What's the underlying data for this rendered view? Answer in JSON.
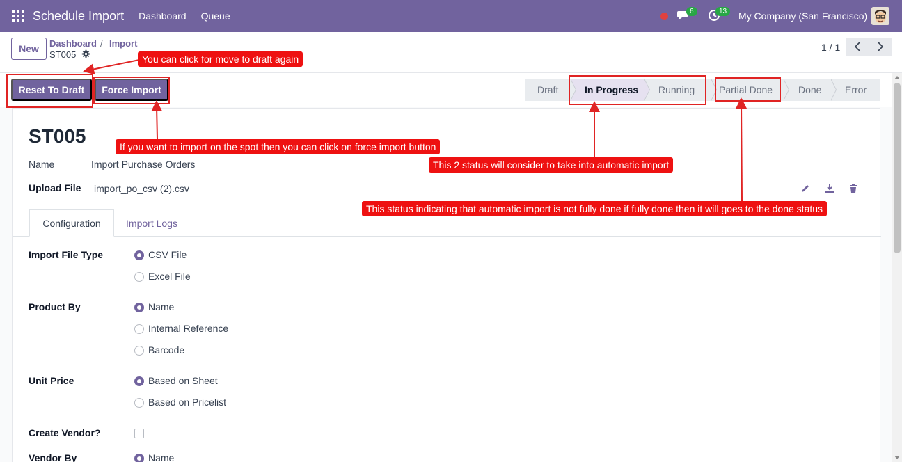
{
  "navbar": {
    "app_title": "Schedule Import",
    "links": [
      "Dashboard",
      "Queue"
    ],
    "messages_badge": "6",
    "activities_badge": "13",
    "company": "My Company (San Francisco)",
    "colors": {
      "brand": "#71639e",
      "badge": "#28a745",
      "recording": "#e0413f"
    }
  },
  "control_panel": {
    "new_label": "New",
    "breadcrumb": {
      "parent": "Dashboard",
      "separator": "/",
      "current": "Import"
    },
    "record_name": "ST005",
    "pager": "1 / 1"
  },
  "statusbar": {
    "buttons": {
      "reset_to_draft": "Reset To Draft",
      "force_import": "Force Import"
    },
    "stages": [
      {
        "label": "Draft",
        "active": false
      },
      {
        "label": "In Progress",
        "active": true
      },
      {
        "label": "Running",
        "active": false
      },
      {
        "label": "Partial Done",
        "active": false
      },
      {
        "label": "Done",
        "active": false
      },
      {
        "label": "Error",
        "active": false
      }
    ]
  },
  "form": {
    "title": "ST005",
    "name_label": "Name",
    "name_value": "Import Purchase Orders",
    "upload_label": "Upload File",
    "upload_value": "import_po_csv (2).csv",
    "tabs": [
      "Configuration",
      "Import Logs"
    ],
    "import_file_type": {
      "label": "Import File Type",
      "options": [
        "CSV File",
        "Excel File"
      ],
      "selected": "CSV File"
    },
    "product_by": {
      "label": "Product By",
      "options": [
        "Name",
        "Internal Reference",
        "Barcode"
      ],
      "selected": "Name"
    },
    "unit_price": {
      "label": "Unit Price",
      "options": [
        "Based on Sheet",
        "Based on Pricelist"
      ],
      "selected": "Based on Sheet"
    },
    "create_vendor": {
      "label": "Create Vendor?",
      "checked": false
    },
    "vendor_by": {
      "label": "Vendor By",
      "options": [
        "Name"
      ],
      "selected": "Name"
    }
  },
  "annotations": {
    "draft_again": "You can click for move to draft again",
    "force_import": "If you want to import on the spot then you can click on force import button",
    "two_status": "This 2 status will consider to take into automatic import",
    "partial_done": "This status indicating that automatic import is not fully done if fully done then it will goes to the done status",
    "color": "#ee1111"
  }
}
